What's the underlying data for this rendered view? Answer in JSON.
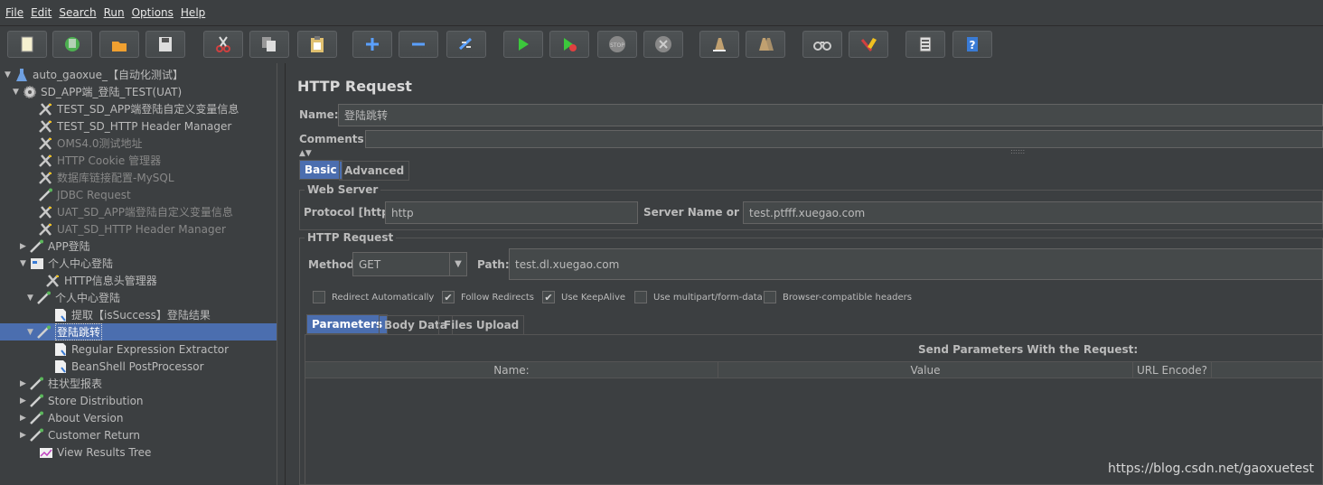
{
  "menu": [
    "File",
    "Edit",
    "Search",
    "Run",
    "Options",
    "Help"
  ],
  "toolbar": [
    {
      "name": "new-icon",
      "color": "#f5f0d0"
    },
    {
      "name": "templates-icon",
      "color": "#4caf50"
    },
    {
      "name": "open-icon",
      "color": "#f0a030"
    },
    {
      "name": "save-icon",
      "color": "#dddddd"
    },
    {
      "name": "cut-icon",
      "color": "#d04040"
    },
    {
      "name": "copy-icon",
      "color": "#dddddd"
    },
    {
      "name": "paste-icon",
      "color": "#e0c070"
    },
    {
      "name": "expand-icon",
      "color": "#5aa0ff"
    },
    {
      "name": "collapse-icon",
      "color": "#5aa0ff"
    },
    {
      "name": "toggle-icon",
      "color": "#5aa0ff"
    },
    {
      "name": "start-icon",
      "color": "#3cc83c"
    },
    {
      "name": "start-no-pause-icon",
      "color": "#3cc83c"
    },
    {
      "name": "stop-icon",
      "color": "#888888"
    },
    {
      "name": "shutdown-icon",
      "color": "#888888"
    },
    {
      "name": "clear-icon",
      "color": "#c0a070"
    },
    {
      "name": "clear-all-icon",
      "color": "#c0a070"
    },
    {
      "name": "search-icon",
      "color": "#cccccc"
    },
    {
      "name": "reset-search-icon",
      "color": "#f0c020"
    },
    {
      "name": "function-helper-icon",
      "color": "#dddddd"
    },
    {
      "name": "help-icon",
      "color": "#3a7bd5"
    }
  ],
  "tree": [
    {
      "label": "auto_gaoxue_【自动化测试】",
      "icon": "flask-icon",
      "arrow": "▼"
    },
    {
      "label": "SD_APP端_登陆_TEST(UAT)",
      "icon": "gear-icon",
      "arrow": "▼"
    },
    {
      "label": "TEST_SD_APP端登陆自定义变量信息",
      "icon": "wrench-icon",
      "arrow": ""
    },
    {
      "label": "TEST_SD_HTTP Header Manager",
      "icon": "wrench-icon",
      "arrow": ""
    },
    {
      "label": "OMS4.0测试地址",
      "icon": "wrench-icon",
      "arrow": "",
      "dim": true
    },
    {
      "label": "HTTP Cookie 管理器",
      "icon": "wrench-icon",
      "arrow": "",
      "dim": true
    },
    {
      "label": "数据库链接配置-MySQL",
      "icon": "wrench-icon",
      "arrow": "",
      "dim": true
    },
    {
      "label": "JDBC Request",
      "icon": "pipette-icon",
      "arrow": "",
      "dim": true
    },
    {
      "label": "UAT_SD_APP端登陆自定义变量信息",
      "icon": "wrench-icon",
      "arrow": "",
      "dim": true
    },
    {
      "label": "UAT_SD_HTTP Header Manager",
      "icon": "wrench-icon",
      "arrow": "",
      "dim": true
    },
    {
      "label": "APP登陆",
      "icon": "pipette-icon",
      "arrow": "▶"
    },
    {
      "label": "个人中心登陆",
      "icon": "module-icon",
      "arrow": "▼"
    },
    {
      "label": "HTTP信息头管理器",
      "icon": "wrench-icon",
      "arrow": ""
    },
    {
      "label": "个人中心登陆",
      "icon": "pipette-icon",
      "arrow": "▼"
    },
    {
      "label": "提取【isSuccess】登陆结果",
      "icon": "doc-icon",
      "arrow": ""
    },
    {
      "label": "登陆跳转",
      "icon": "pipette-icon",
      "arrow": "▼",
      "selected": true
    },
    {
      "label": "Regular Expression Extractor",
      "icon": "doc-icon",
      "arrow": ""
    },
    {
      "label": "BeanShell PostProcessor",
      "icon": "doc-icon",
      "arrow": ""
    },
    {
      "label": "柱状型报表",
      "icon": "pipette-icon",
      "arrow": "▶"
    },
    {
      "label": "Store Distribution",
      "icon": "pipette-icon",
      "arrow": "▶"
    },
    {
      "label": "About Version",
      "icon": "pipette-icon",
      "arrow": "▶"
    },
    {
      "label": "Customer Return",
      "icon": "pipette-icon",
      "arrow": "▶"
    },
    {
      "label": "View Results Tree",
      "icon": "chart-icon",
      "arrow": ""
    }
  ],
  "panel": {
    "title": "HTTP Request",
    "name_label": "Name:",
    "name_value": "登陆跳转",
    "comments_label": "Comments:",
    "tabs": [
      "Basic",
      "Advanced"
    ],
    "web_server_title": "Web Server",
    "protocol_label": "Protocol [http]:",
    "protocol_value": "http",
    "server_label": "Server Name or IP:",
    "server_value": "test.ptfff.xuegao.com",
    "http_request_title": "HTTP Request",
    "method_label": "Method:",
    "method_value": "GET",
    "path_label": "Path:",
    "path_value": "test.dl.xuegao.com",
    "checkboxes": [
      {
        "label": "Redirect Automatically",
        "checked": false
      },
      {
        "label": "Follow Redirects",
        "checked": true
      },
      {
        "label": "Use KeepAlive",
        "checked": true
      },
      {
        "label": "Use multipart/form-data",
        "checked": false
      },
      {
        "label": "Browser-compatible headers",
        "checked": false
      }
    ],
    "param_tabs": [
      "Parameters",
      "Body Data",
      "Files Upload"
    ],
    "send_params_title": "Send Parameters With the Request:",
    "columns": [
      "Name:",
      "Value",
      "URL Encode?"
    ]
  },
  "watermark": "https://blog.csdn.net/gaoxuetest"
}
